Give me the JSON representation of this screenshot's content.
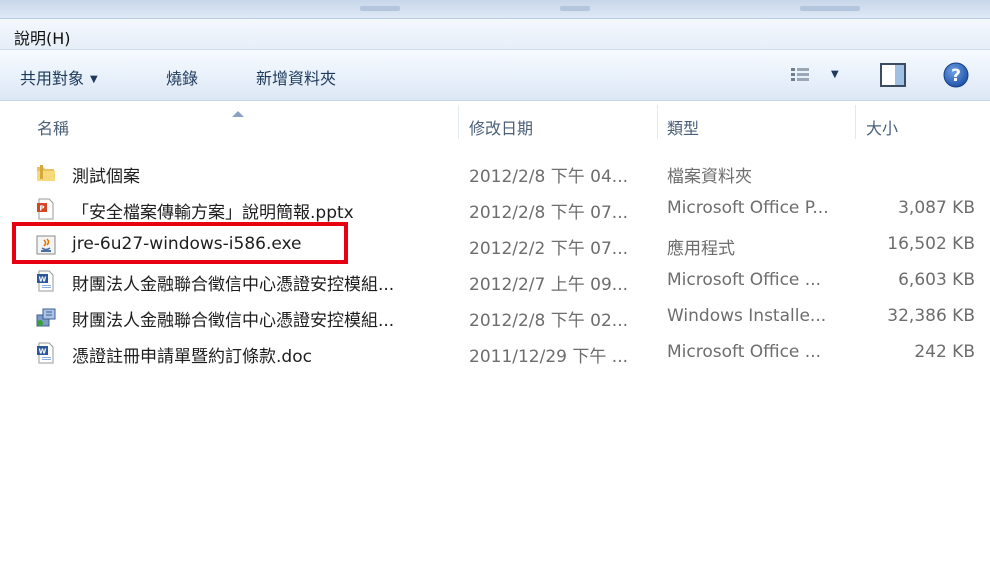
{
  "menu": {
    "help": "說明(H)"
  },
  "toolbar": {
    "share_with": "共用對象",
    "burn": "燒錄",
    "new_folder": "新增資料夾"
  },
  "columns": {
    "name": "名稱",
    "date": "修改日期",
    "type": "類型",
    "size": "大小"
  },
  "files": [
    {
      "name": "測試個案",
      "date": "2012/2/8 下午 04...",
      "type": "檔案資料夾",
      "size": "",
      "icon": "folder-icon"
    },
    {
      "name": "「安全檔案傳輸方案」說明簡報.pptx",
      "date": "2012/2/8 下午 07...",
      "type": "Microsoft Office P...",
      "size": "3,087 KB",
      "icon": "powerpoint-icon"
    },
    {
      "name": "jre-6u27-windows-i586.exe",
      "date": "2012/2/2 下午 07...",
      "type": "應用程式",
      "size": "16,502 KB",
      "icon": "java-exe-icon"
    },
    {
      "name": "財團法人金融聯合徵信中心憑證安控模組...",
      "date": "2012/2/7 上午 09...",
      "type": "Microsoft Office ...",
      "size": "6,603 KB",
      "icon": "word-doc-icon"
    },
    {
      "name": "財團法人金融聯合徵信中心憑證安控模組...",
      "date": "2012/2/8 下午 02...",
      "type": "Windows Installe...",
      "size": "32,386 KB",
      "icon": "installer-icon"
    },
    {
      "name": "憑證註冊申請單暨約訂條款.doc",
      "date": "2011/12/29 下午 ...",
      "type": "Microsoft Office ...",
      "size": "242 KB",
      "icon": "word-doc-icon"
    }
  ],
  "colors": {
    "highlight": "#e60012",
    "toolbar_text": "#1e395b",
    "help_blue": "#2a62b8"
  }
}
